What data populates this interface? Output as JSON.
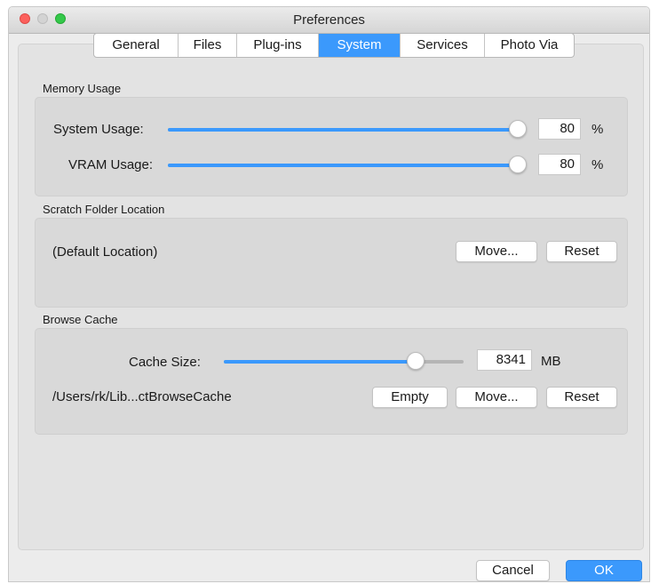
{
  "window": {
    "title": "Preferences"
  },
  "tabs": [
    {
      "label": "General",
      "active": false
    },
    {
      "label": "Files",
      "active": false
    },
    {
      "label": "Plug-ins",
      "active": false
    },
    {
      "label": "System",
      "active": true
    },
    {
      "label": "Services",
      "active": false
    },
    {
      "label": "Photo Via",
      "active": false
    }
  ],
  "memory": {
    "section_label": "Memory Usage",
    "system_label": "System Usage:",
    "system_value": "80",
    "system_level": 0.98,
    "vram_label": "VRAM Usage:",
    "vram_value": "80",
    "vram_level": 0.98,
    "unit": "%"
  },
  "scratch": {
    "section_label": "Scratch Folder Location",
    "path": "(Default Location)",
    "move_label": "Move...",
    "reset_label": "Reset"
  },
  "cache": {
    "section_label": "Browse Cache",
    "size_label": "Cache Size:",
    "size_value": "8341",
    "size_level": 0.8,
    "unit": "MB",
    "path": "/Users/rk/Lib...ctBrowseCache",
    "empty_label": "Empty",
    "move_label": "Move...",
    "reset_label": "Reset"
  },
  "footer": {
    "cancel_label": "Cancel",
    "ok_label": "OK"
  },
  "colors": {
    "accent": "#3b99fc",
    "close": "#fc605c",
    "zoom": "#34c84a"
  }
}
